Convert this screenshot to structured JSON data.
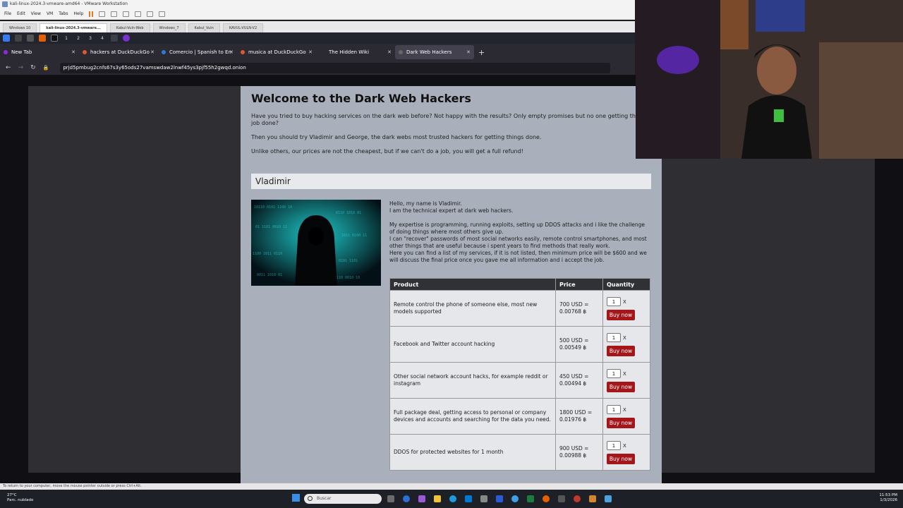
{
  "vmware": {
    "title": "kali-linux-2024.3-vmware-amd64 - VMware Workstation",
    "menu": [
      "File",
      "Edit",
      "View",
      "VM",
      "Tabs",
      "Help"
    ],
    "tabs": [
      "Windows 10",
      "kali-linux-2024.3-vmware...",
      "Kabul-Vuln-Web",
      "Windows_7",
      "Kabul_Vuln",
      "KAVUL-VULN-V2"
    ],
    "status_hint": "To return to your computer, move the mouse pointer outside or press Ctrl+Alt."
  },
  "kali": {
    "workspaces": [
      "1",
      "2",
      "3",
      "4"
    ]
  },
  "browser": {
    "tabs": [
      {
        "label": "New Tab",
        "color": "#8a2be2"
      },
      {
        "label": "hackers at DuckDuckGo",
        "color": "#de5833"
      },
      {
        "label": "Comercio | Spanish to En",
        "color": "#2f7bd6"
      },
      {
        "label": "musica at DuckDuckGo",
        "color": "#de5833"
      },
      {
        "label": "The Hidden Wiki",
        "color": ""
      },
      {
        "label": "Dark Web Hackers",
        "color": "#666"
      }
    ],
    "url": "prjd5pmbug2cnfs67s3y65ods27vamswdaw2lnwf45ys3pjf55h2gwqd.onion"
  },
  "page": {
    "title": "Welcome to the Dark Web Hackers",
    "intro1": "Have you tried to buy hacking services on the dark web before? Not happy with the results? Only empty promises but no one getting the job done?",
    "intro2": "Then you should try Vladimir and George, the dark webs most trusted hackers for getting things done.",
    "intro3": "Unlike others, our prices are not the cheapest, but if we can't do a job, you will get a full refund!",
    "section": "Vladimir",
    "bio1": "Hello, my name is Vladimir.",
    "bio2": "I am the technical expert at dark web hackers.",
    "bio3": "My expertise is programming, running exploits, setting up DDOS attacks and i like the challenge of doing things where most others give up.",
    "bio4": "I can \"recover\" passwords of most social networks easily, remote control smartphones, and most other things that are useful because i spent years to find methods that really work.",
    "bio5": "Here you can find a list of my services, if it is not listed, then minimum price will be $600 and we will discuss the final price once you gave me all information and i accept the job.",
    "headers": [
      "Product",
      "Price",
      "Quantity"
    ],
    "products": [
      {
        "name": "Remote control the phone of someone else, most new models supported",
        "usd": "700 USD =",
        "btc": "0.00768 ฿",
        "qty": "1",
        "buy": "Buy now"
      },
      {
        "name": "Facebook and Twitter account hacking",
        "usd": "500 USD =",
        "btc": "0.00549 ฿",
        "qty": "1",
        "buy": "Buy now"
      },
      {
        "name": "Other social network account hacks, for example reddit or instagram",
        "usd": "450 USD =",
        "btc": "0.00494 ฿",
        "qty": "1",
        "buy": "Buy now"
      },
      {
        "name": "Full package deal, getting access to personal or company devices and accounts and searching for the data you need.",
        "usd": "1800 USD =",
        "btc": "0.01976 ฿",
        "qty": "1",
        "buy": "Buy now"
      },
      {
        "name": "DDOS for protected websites for 1 month",
        "usd": "900 USD =",
        "btc": "0.00988 ฿",
        "qty": "1",
        "buy": "Buy now"
      }
    ]
  },
  "taskbar": {
    "weather_temp": "27°C",
    "weather_desc": "Parc. nublado",
    "search_placeholder": "Buscar",
    "time": "11:53 PM",
    "date": "1/3/2026"
  },
  "colors": {
    "accent_buy": "#a4161a",
    "page_bg": "#aab0bb",
    "header_bg": "#2f3136"
  }
}
